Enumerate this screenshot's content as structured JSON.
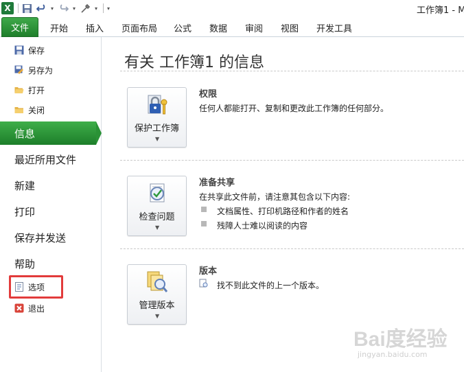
{
  "window": {
    "title": "工作簿1 - M"
  },
  "ribbon": {
    "file_tab": "文件",
    "tabs": [
      "开始",
      "插入",
      "页面布局",
      "公式",
      "数据",
      "审阅",
      "视图",
      "开发工具"
    ]
  },
  "backstage": {
    "commands": [
      {
        "label": "保存",
        "icon": "save-icon"
      },
      {
        "label": "另存为",
        "icon": "save-as-icon"
      },
      {
        "label": "打开",
        "icon": "open-folder-icon"
      },
      {
        "label": "关闭",
        "icon": "close-folder-icon"
      }
    ],
    "nav": [
      {
        "label": "信息",
        "active": true
      },
      {
        "label": "最近所用文件"
      },
      {
        "label": "新建"
      },
      {
        "label": "打印"
      },
      {
        "label": "保存并发送"
      },
      {
        "label": "帮助"
      }
    ],
    "bottom_commands": [
      {
        "label": "选项",
        "icon": "options-icon"
      },
      {
        "label": "退出",
        "icon": "exit-icon"
      }
    ]
  },
  "info": {
    "title": "有关 工作簿1 的信息",
    "sections": [
      {
        "button": "保护工作簿",
        "icon": "lock-key-icon",
        "heading": "权限",
        "text": "任何人都能打开、复制和更改此工作簿的任何部分。"
      },
      {
        "button": "检查问题",
        "icon": "checklist-icon",
        "heading": "准备共享",
        "text": "在共享此文件前，请注意其包含以下内容:",
        "bullets": [
          "文档属性、打印机路径和作者的姓名",
          "残障人士难以阅读的内容"
        ]
      },
      {
        "button": "管理版本",
        "icon": "versions-icon",
        "heading": "版本",
        "text": "找不到此文件的上一个版本。"
      }
    ]
  },
  "watermark": {
    "text": "Bai度经验",
    "url": "jingyan.baidu.com"
  },
  "colors": {
    "accent_green": "#2a9236",
    "highlight_red": "#e23b3b"
  }
}
